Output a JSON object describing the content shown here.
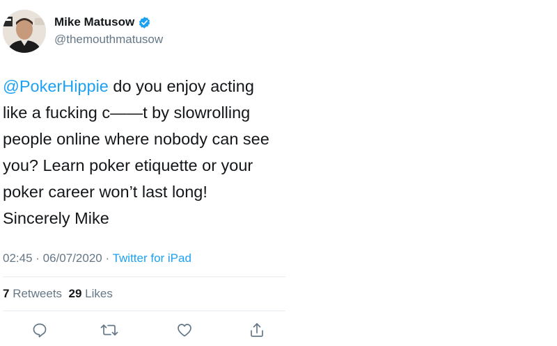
{
  "author": {
    "display_name": "Mike Matusow",
    "handle": "@themouthmatusow",
    "verified": true
  },
  "tweet": {
    "mention": "@PokerHippie",
    "lines": [
      " do you enjoy acting",
      "like a fucking c——t by slowrolling",
      "people online where nobody can see",
      "you? Learn poker etiquette or your",
      "poker career won’t last long!",
      "Sincerely Mike"
    ]
  },
  "meta": {
    "time": "02:45",
    "separator": " · ",
    "date": "06/07/2020",
    "source": "Twitter for iPad"
  },
  "stats": {
    "retweets_count": "7",
    "retweets_label": " Retweets",
    "likes_count": "29",
    "likes_label": " Likes"
  },
  "actions": [
    "reply-icon",
    "retweet-icon",
    "like-icon",
    "share-icon"
  ],
  "colors": {
    "link": "#1da1f2",
    "muted": "#657786",
    "text": "#14171a",
    "divider": "#e6ecf0"
  }
}
